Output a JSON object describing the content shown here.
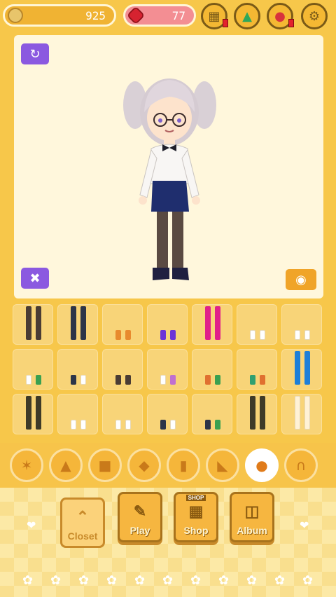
{
  "currency": {
    "coins": "925",
    "gems": "77"
  },
  "top_icons": [
    "chest-icon",
    "spool-icon",
    "medal-icon",
    "gear-icon"
  ],
  "grid": [
    [
      [
        "#4a3c34",
        "#4a3c34"
      ],
      [
        "#2d3548",
        "#2d3548"
      ],
      [
        "#e88a2e",
        "#e88a2e"
      ],
      [
        "#6d33d8",
        "#6d33d8"
      ],
      [
        "#e0208a",
        "#e0208a"
      ],
      [
        "#ffffff",
        "#ffffff"
      ],
      [
        "#ffffff",
        "#ffffff"
      ]
    ],
    [
      [
        "#ffffff",
        "#3aa050"
      ],
      [
        "#2d3548",
        "#ffffff"
      ],
      [
        "#4a3c34",
        "#4a3c34"
      ],
      [
        "#ffffff",
        "#c070d0"
      ],
      [
        "#e07030",
        "#3aa050"
      ],
      [
        "#2fa070",
        "#e07030"
      ],
      [
        "#1d7fd8",
        "#1d7fd8"
      ]
    ],
    [
      [
        "#3e3a28",
        "#3e3a28"
      ],
      [
        "#ffffff",
        "#ffffff"
      ],
      [
        "#ffffff",
        "#ffffff"
      ],
      [
        "#2d3548",
        "#ffffff"
      ],
      [
        "#2d3548",
        "#3aa050"
      ],
      [
        "#3e3a28",
        "#3e3a28"
      ],
      [
        "#fff2d6",
        "#fff2d6"
      ]
    ]
  ],
  "categories": [
    {
      "name": "jacket-icon",
      "glyph": "✶"
    },
    {
      "name": "dress-icon",
      "glyph": "▲"
    },
    {
      "name": "shirt-icon",
      "glyph": "■"
    },
    {
      "name": "skirt-icon",
      "glyph": "◆"
    },
    {
      "name": "pants-icon",
      "glyph": "▮"
    },
    {
      "name": "shoe-icon",
      "glyph": "◣"
    },
    {
      "name": "sock-icon",
      "glyph": "●"
    },
    {
      "name": "tights-icon",
      "glyph": "∩"
    }
  ],
  "nav": {
    "closet": "Closet",
    "play": "Play",
    "shop": "Shop",
    "shop_tag": "SHOP",
    "album": "Album"
  }
}
